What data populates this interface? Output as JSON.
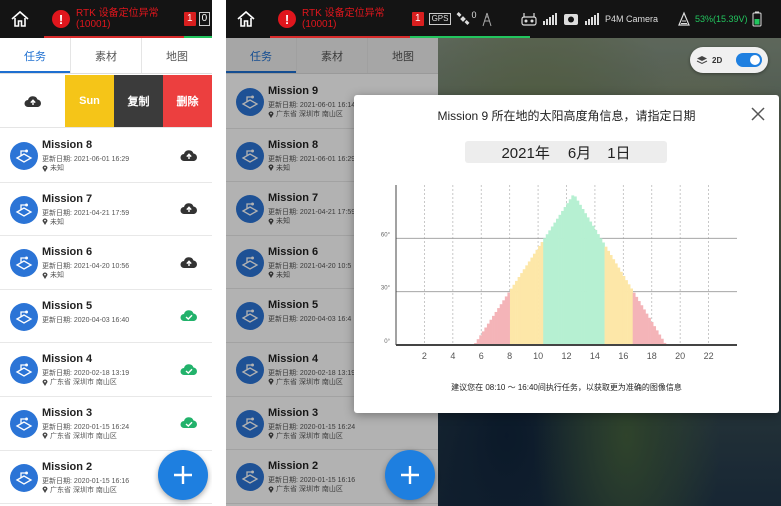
{
  "top_bar": {
    "warning_code_icon": "!",
    "warning_line1": "RTK 设备定位异常",
    "warning_line2": "(10001)",
    "left_badge": "1",
    "left_badge_partial": "0",
    "right_badge": "1",
    "gps_label": "GPS",
    "signal_value": "0",
    "camera_label": "P4M Camera",
    "battery_text": "53%(15.39V)"
  },
  "tabs": [
    "任务",
    "素材",
    "地图"
  ],
  "actions": {
    "upload_icon": "cloud-upload-icon",
    "sun": "Sun",
    "copy": "复制",
    "delete": "删除"
  },
  "left_missions": [
    {
      "name": "Mission 8",
      "date": "更新日期: 2021-06-01 16:29",
      "location": "未知",
      "status": "upload"
    },
    {
      "name": "Mission 7",
      "date": "更新日期: 2021-04-21 17:59",
      "location": "未知",
      "status": "upload"
    },
    {
      "name": "Mission 6",
      "date": "更新日期: 2021-04-20 10:56",
      "location": "未知",
      "status": "upload"
    },
    {
      "name": "Mission 5",
      "date": "更新日期: 2020-04-03 16:40",
      "location": "",
      "status": "done"
    },
    {
      "name": "Mission 4",
      "date": "更新日期: 2020-02-18 13:19",
      "location": "广东省 深圳市 南山区",
      "status": "done"
    },
    {
      "name": "Mission 3",
      "date": "更新日期: 2020-01-15 16:24",
      "location": "广东省 深圳市 南山区",
      "status": "done"
    },
    {
      "name": "Mission 2",
      "date": "更新日期: 2020-01-15 16:16",
      "location": "广东省 深圳市 南山区",
      "status": "none"
    }
  ],
  "right_missions": [
    {
      "name": "Mission 9",
      "date": "更新日期: 2021-06-01 16:14",
      "location": "广东省 深圳市 南山区"
    },
    {
      "name": "Mission 8",
      "date": "更新日期: 2021-06-01 16:29",
      "location": "未知"
    },
    {
      "name": "Mission 7",
      "date": "更新日期: 2021-04-21 17:59",
      "location": "未知"
    },
    {
      "name": "Mission 6",
      "date": "更新日期: 2021-04-20 10:5",
      "location": "未知"
    },
    {
      "name": "Mission 5",
      "date": "更新日期: 2020-04-03 16:4",
      "location": ""
    },
    {
      "name": "Mission 4",
      "date": "更新日期: 2020-02-18 13:19",
      "location": "广东省 深圳市 南山区"
    },
    {
      "name": "Mission 3",
      "date": "更新日期: 2020-01-15 16:24",
      "location": "广东省 深圳市 南山区"
    },
    {
      "name": "Mission 2",
      "date": "更新日期: 2020-01-15 16:16",
      "location": "广东省 深圳市 南山区"
    }
  ],
  "map_toggle": {
    "label": "2D"
  },
  "modal": {
    "title": "Mission 9 所在地的太阳高度角信息，请指定日期",
    "year": "2021年",
    "month": "6月",
    "day": "1日",
    "advice": "建议您在 08:10 ～ 16:40间执行任务，以获取更为准确的图像信息"
  },
  "chart_data": {
    "type": "area",
    "x_ticks": [
      "2",
      "4",
      "6",
      "8",
      "10",
      "12",
      "14",
      "16",
      "18",
      "20",
      "22"
    ],
    "y_ticks": [
      "0°",
      "30°",
      "60°"
    ],
    "xlim": [
      0,
      24
    ],
    "ylim": [
      0,
      90
    ],
    "peak": {
      "x": 12.5,
      "y": 85
    },
    "sunrise": 5.5,
    "sunset": 19.0,
    "zones": [
      {
        "from": 5.5,
        "to": 8.1,
        "color": "#f4b4b8"
      },
      {
        "from": 8.1,
        "to": 10.3,
        "color": "#fde7a8"
      },
      {
        "from": 10.3,
        "to": 14.6,
        "color": "#b6f0d2"
      },
      {
        "from": 14.6,
        "to": 16.7,
        "color": "#fde7a8"
      },
      {
        "from": 16.7,
        "to": 19.0,
        "color": "#f4b4b8"
      }
    ]
  }
}
